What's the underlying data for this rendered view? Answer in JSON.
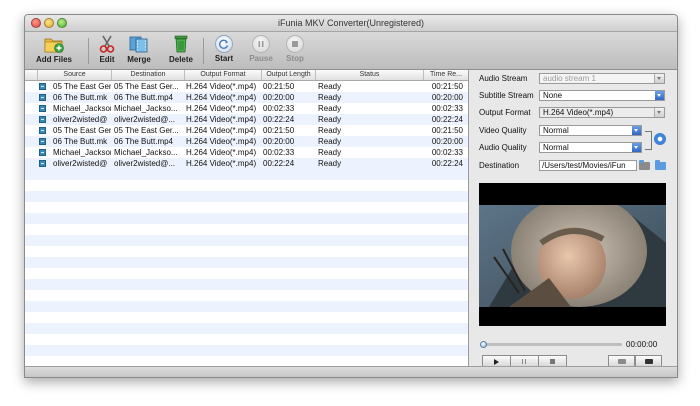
{
  "window": {
    "title": "iFunia MKV Converter(Unregistered)"
  },
  "toolbar": {
    "add_files": "Add Files",
    "edit": "Edit",
    "merge": "Merge",
    "delete": "Delete",
    "start": "Start",
    "pause": "Pause",
    "stop": "Stop"
  },
  "list": {
    "columns": [
      "Source",
      "Destination",
      "Output Format",
      "Output Length",
      "Status",
      "Time Re..."
    ],
    "rows": [
      {
        "source": "05 The East Ger",
        "destination": "05 The East Ger...",
        "format": "H.264 Video(*.mp4)",
        "length": "00:21:50",
        "status": "Ready",
        "time": "00:21:50"
      },
      {
        "source": "06 The Butt.mk",
        "destination": "06 The Butt.mp4",
        "format": "H.264 Video(*.mp4)",
        "length": "00:20:00",
        "status": "Ready",
        "time": "00:20:00"
      },
      {
        "source": "Michael_Jackson",
        "destination": "Michael_Jackso...",
        "format": "H.264 Video(*.mp4)",
        "length": "00:02:33",
        "status": "Ready",
        "time": "00:02:33"
      },
      {
        "source": "oliver2wisted@",
        "destination": "oliver2wisted@...",
        "format": "H.264 Video(*.mp4)",
        "length": "00:22:24",
        "status": "Ready",
        "time": "00:22:24"
      },
      {
        "source": "05 The East Ger",
        "destination": "05 The East Ger...",
        "format": "H.264 Video(*.mp4)",
        "length": "00:21:50",
        "status": "Ready",
        "time": "00:21:50"
      },
      {
        "source": "06 The Butt.mk",
        "destination": "06 The Butt.mp4",
        "format": "H.264 Video(*.mp4)",
        "length": "00:20:00",
        "status": "Ready",
        "time": "00:20:00"
      },
      {
        "source": "Michael_Jackson",
        "destination": "Michael_Jackso...",
        "format": "H.264 Video(*.mp4)",
        "length": "00:02:33",
        "status": "Ready",
        "time": "00:02:33"
      },
      {
        "source": "oliver2wisted@",
        "destination": "oliver2wisted@...",
        "format": "H.264 Video(*.mp4)",
        "length": "00:22:24",
        "status": "Ready",
        "time": "00:22:24"
      }
    ]
  },
  "settings": {
    "audio_stream_label": "Audio Stream",
    "audio_stream_value": "audio stream 1",
    "subtitle_stream_label": "Subtitle Stream",
    "subtitle_stream_value": "None",
    "output_format_label": "Output Format",
    "output_format_value": "H.264 Video(*.mp4)",
    "video_quality_label": "Video Quality",
    "video_quality_value": "Normal",
    "audio_quality_label": "Audio Quality",
    "audio_quality_value": "Normal",
    "destination_label": "Destination",
    "destination_value": "/Users/test/Movies/iFun"
  },
  "player": {
    "time": "00:00:00",
    "progress": 0
  },
  "colors": {
    "row_alt": "#edf3fe",
    "accent": "#3f86d8"
  }
}
